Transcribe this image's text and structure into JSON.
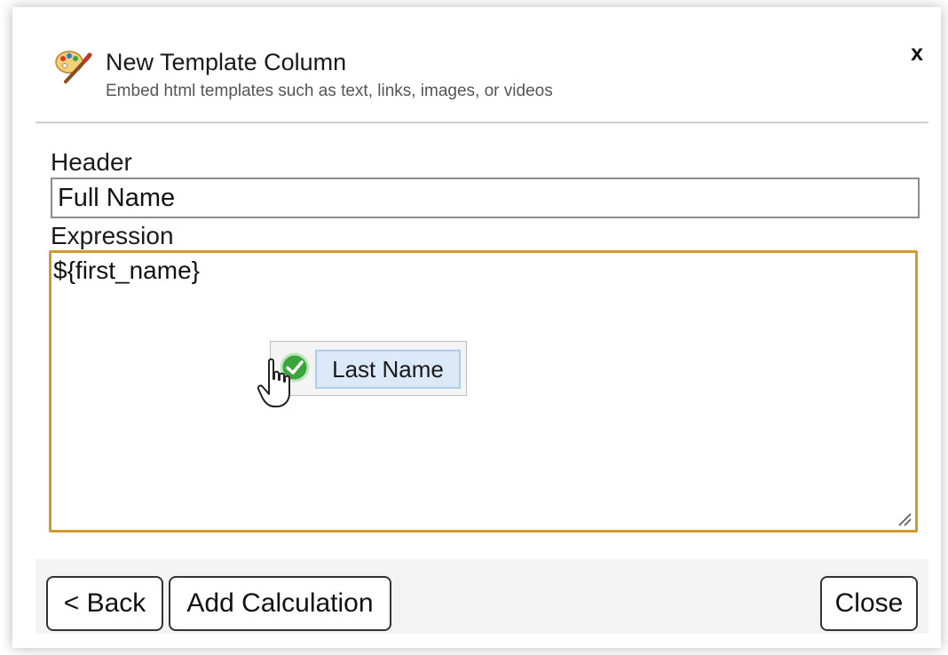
{
  "dialog": {
    "title": "New Template Column",
    "subtitle": "Embed html templates such as text, links, images, or videos",
    "close_glyph": "x",
    "title_icon": "palette-brush-icon"
  },
  "form": {
    "header_label": "Header",
    "header_value": "Full Name",
    "expression_label": "Expression",
    "expression_value": "${first_name}"
  },
  "drag_item": {
    "label": "Last Name",
    "status_icon": "check-circle-icon",
    "cursor_icon": "hand-cursor-icon"
  },
  "footer": {
    "back_label": "< Back",
    "calc_label": "Add Calculation",
    "close_label": "Close"
  },
  "colors": {
    "focus_border": "#d39a2a",
    "chip_background": "#dbe9f9",
    "chip_border": "#aecdee",
    "check_green": "#3aa53a",
    "footer_background": "#f3f3f3"
  }
}
